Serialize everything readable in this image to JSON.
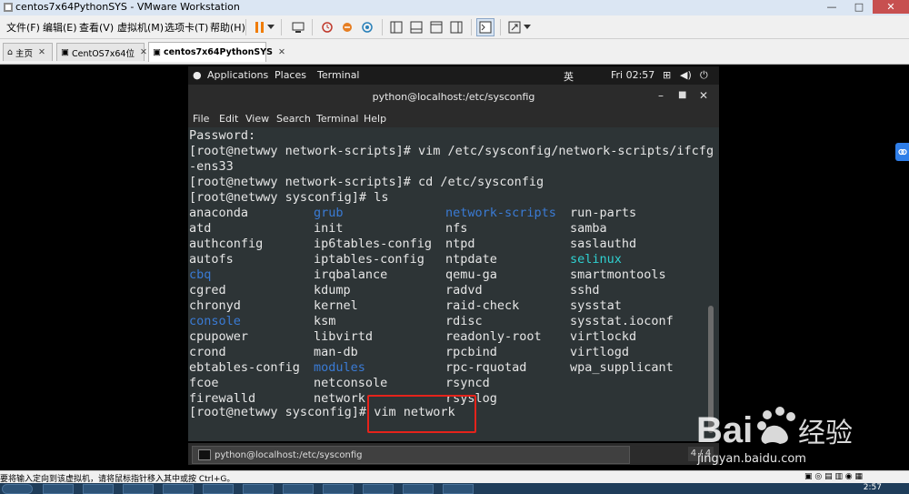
{
  "window": {
    "title": "centos7x64PythonSYS - VMware Workstation",
    "controls": {
      "minimize": "—",
      "maximize": "□",
      "close": "✕"
    }
  },
  "menubar": {
    "items": [
      "文件(F)",
      "编辑(E)",
      "查看(V)",
      "虚拟机(M)",
      "选项卡(T)",
      "帮助(H)"
    ]
  },
  "tabs": [
    {
      "label": "主页",
      "icon": "home-icon",
      "active": false
    },
    {
      "label": "CentOS7x64位",
      "icon": "vm-icon",
      "active": false
    },
    {
      "label": "centos7x64PythonSYS",
      "icon": "vm-icon",
      "active": true
    }
  ],
  "gnome": {
    "applications": "Applications",
    "places": "Places",
    "terminal": "Terminal",
    "input_method": "英",
    "clock": "Fri 02:57"
  },
  "terminal": {
    "title": "python@localhost:/etc/sysconfig",
    "menu": [
      "File",
      "Edit",
      "View",
      "Search",
      "Terminal",
      "Help"
    ],
    "lines": [
      "Password:",
      "[root@netwwy network-scripts]# vim /etc/sysconfig/network-scripts/ifcfg",
      "-ens33",
      "[root@netwwy network-scripts]# cd /etc/sysconfig",
      "[root@netwwy sysconfig]# ls"
    ],
    "ls_columns": [
      [
        "anaconda",
        "atd",
        "authconfig",
        "autofs",
        "cbq",
        "cgred",
        "chronyd",
        "console",
        "cpupower",
        "crond",
        "ebtables-config",
        "fcoe",
        "firewalld"
      ],
      [
        "grub",
        "init",
        "ip6tables-config",
        "iptables-config",
        "irqbalance",
        "kdump",
        "kernel",
        "ksm",
        "libvirtd",
        "man-db",
        "modules",
        "netconsole",
        "network"
      ],
      [
        "network-scripts",
        "nfs",
        "ntpd",
        "ntpdate",
        "qemu-ga",
        "radvd",
        "raid-check",
        "rdisc",
        "readonly-root",
        "rpcbind",
        "rpc-rquotad",
        "rsyncd",
        "rsyslog"
      ],
      [
        "run-parts",
        "samba",
        "saslauthd",
        "selinux",
        "smartmontools",
        "sshd",
        "sysstat",
        "sysstat.ioconf",
        "virtlockd",
        "virtlogd",
        "wpa_supplicant"
      ]
    ],
    "dir_entries": [
      "grub",
      "network-scripts",
      "selinux",
      "cbq",
      "console",
      "modules"
    ],
    "link_entries": [
      "selinux"
    ],
    "prompt": "[root@netwwy sysconfig]#",
    "command": "vim network",
    "taskbar_item": "python@localhost:/etc/sysconfig",
    "page_indicator": "4 / 4"
  },
  "colors": {
    "terminal_bg": "#2d3436",
    "terminal_fg": "#e6e6e6",
    "dir_blue": "#3a7bd5",
    "link_cyan": "#2fd0d0",
    "highlight_red": "#e5231b"
  },
  "statusbar": {
    "message": "要将输入定向到该虚拟机，请将鼠标指针移入其中或按 Ctrl+G。"
  },
  "watermark": {
    "brand": "Baidu经验",
    "url": "jingyan.baidu.com"
  },
  "system_clock": "2:57"
}
